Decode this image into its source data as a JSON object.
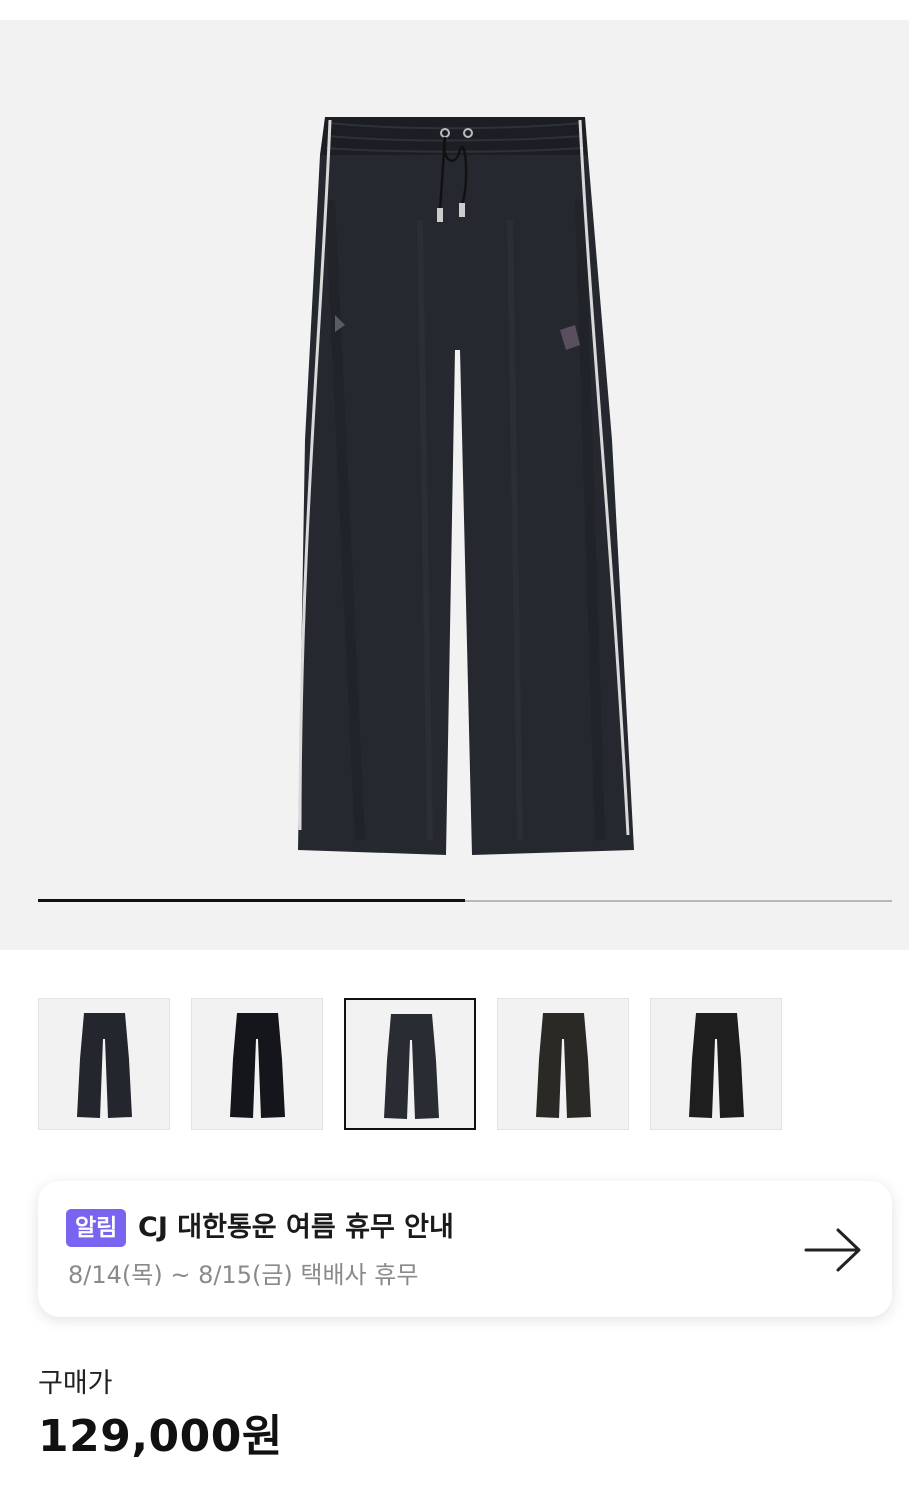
{
  "gallery": {
    "current_slide": 1,
    "total_slides": 2,
    "progress": 0.5
  },
  "thumbnails": [
    {
      "color": "#23262d",
      "selected": false
    },
    {
      "color": "#15161b",
      "selected": false
    },
    {
      "color": "#2a2c33",
      "selected": true
    },
    {
      "color": "#2b2926",
      "selected": false
    },
    {
      "color": "#1e1e1e",
      "selected": false
    }
  ],
  "notice": {
    "badge": "알림",
    "title": "CJ 대한통운 여름 휴무 안내",
    "subtitle": "8/14(목) ~ 8/15(금) 택배사 휴무",
    "icon": "arrow-right-icon"
  },
  "price": {
    "label": "구매가",
    "value": "129,000원"
  },
  "colors": {
    "badge_bg": "#7864f0",
    "hero_bg": "#f2f2f2",
    "pants": "#23262d"
  }
}
